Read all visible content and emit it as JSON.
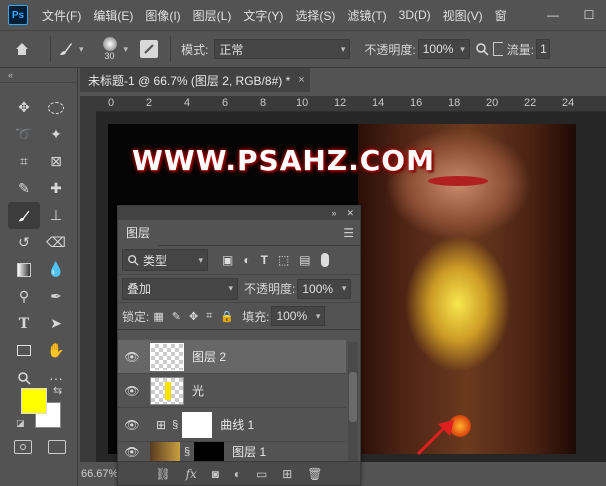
{
  "menubar": {
    "app_icon": "Ps",
    "items": [
      "文件(F)",
      "编辑(E)",
      "图像(I)",
      "图层(L)",
      "文字(Y)",
      "选择(S)",
      "滤镜(T)",
      "3D(D)",
      "视图(V)",
      "窗"
    ],
    "minimize": "—",
    "maximize": "☐"
  },
  "options": {
    "brush_size": "30",
    "mode_label": "模式:",
    "mode_value": "正常",
    "opacity_label": "不透明度:",
    "opacity_value": "100%",
    "flow_label": "流量:",
    "flow_value": "1"
  },
  "document": {
    "tab_title": "未标题-1 @ 66.7% (图层 2, RGB/8#) *",
    "close": "×",
    "zoom": "66.67%",
    "watermark": "WWW.PSAHZ.COM"
  },
  "ruler": {
    "ticks": [
      "0",
      "2",
      "4",
      "6",
      "8",
      "10",
      "12",
      "14",
      "16",
      "18",
      "20",
      "22",
      "24"
    ]
  },
  "swatches": {
    "foreground": "#ffff00",
    "background": "#ffffff"
  },
  "layers_panel": {
    "tab": "图层",
    "filter_label": "类型",
    "blend_mode": "叠加",
    "opacity_label": "不透明度:",
    "opacity_value": "100%",
    "lock_label": "锁定:",
    "fill_label": "填充:",
    "fill_value": "100%",
    "layers": [
      {
        "name": "图层 2",
        "selected": true
      },
      {
        "name": "光",
        "selected": false
      },
      {
        "name": "曲线 1",
        "selected": false
      },
      {
        "name": "图层 1",
        "selected": false
      }
    ]
  }
}
